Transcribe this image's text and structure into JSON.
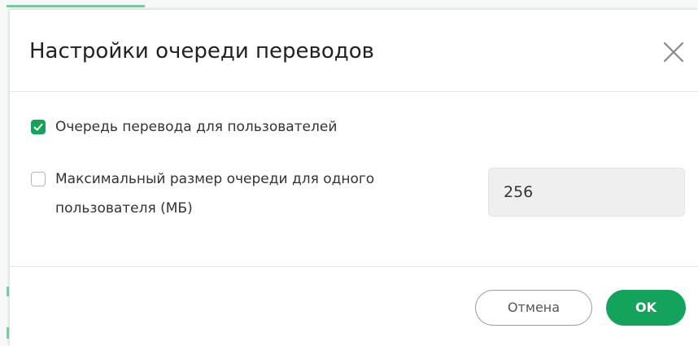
{
  "dialog": {
    "title": "Настройки очереди переводов",
    "close_icon": "close-icon"
  },
  "options": {
    "user_queue": {
      "label": "Очередь перевода для пользователей",
      "checked": true
    },
    "max_size": {
      "label_line1": "Максимальный размер очереди для одного",
      "label_line2": "пользователя (МБ)",
      "checked": false,
      "value": "256"
    }
  },
  "footer": {
    "cancel_label": "Отмена",
    "ok_label": "OK"
  },
  "colors": {
    "accent": "#14a35a",
    "input_bg": "#efefef",
    "title_text": "#222222",
    "body_text": "#333333"
  }
}
